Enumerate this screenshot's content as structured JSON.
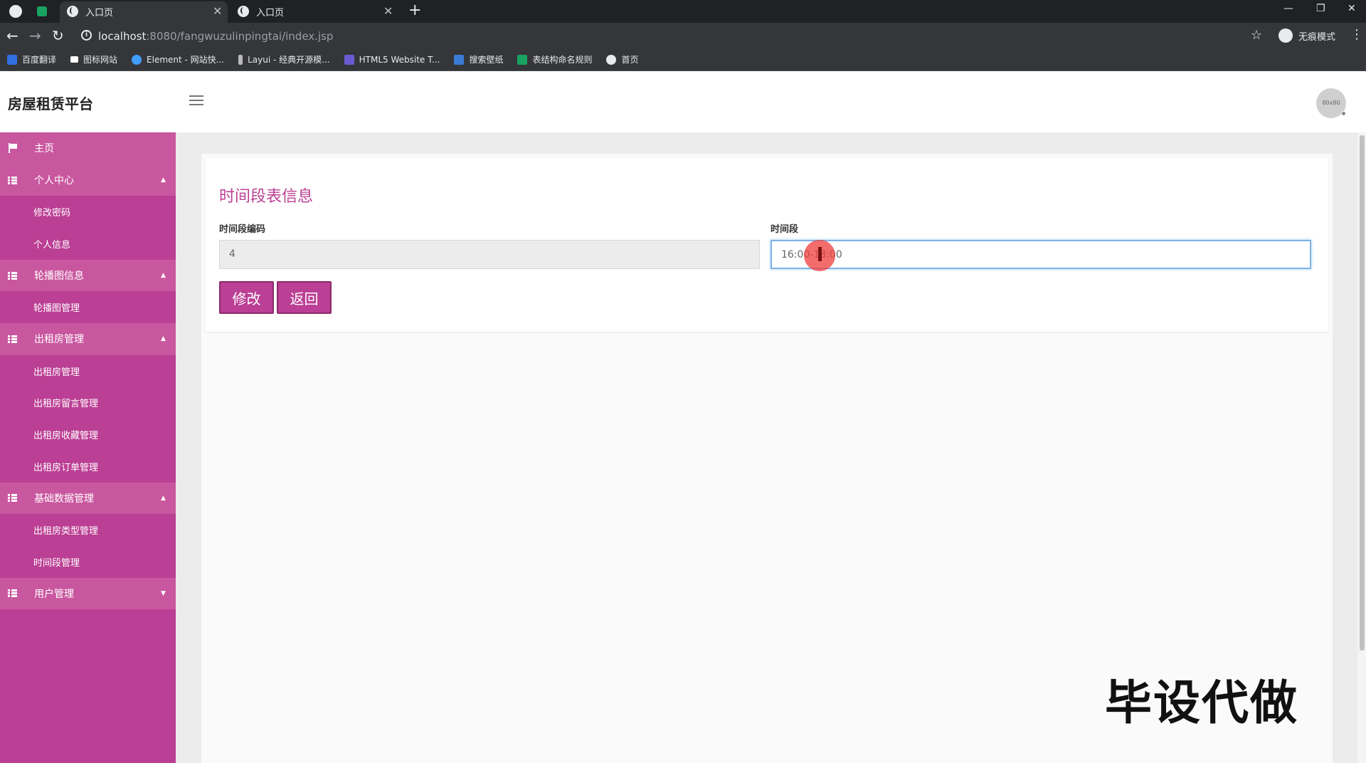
{
  "browser": {
    "tabs": [
      {
        "label": "入口页",
        "active": true
      },
      {
        "label": "入口页",
        "active": false
      }
    ],
    "url_host": "localhost",
    "url_rest": ":8080/fangwuzulinpingtai/index.jsp",
    "incognito_label": "无痕模式",
    "bookmarks": [
      {
        "label": "百度翻译",
        "color": "#2f6fde"
      },
      {
        "label": "图标网站",
        "color": "#ffffff"
      },
      {
        "label": "Element - 网站快...",
        "color": "#409eff"
      },
      {
        "label": "Layui - 经典开源模...",
        "color": "#bbbbbb"
      },
      {
        "label": "HTML5 Website T...",
        "color": "#6b5bd3"
      },
      {
        "label": "搜索壁纸",
        "color": "#3a7bd5"
      },
      {
        "label": "表结构命名规则",
        "color": "#1aa260"
      },
      {
        "label": "首页",
        "color": "#e8eaed"
      }
    ]
  },
  "app": {
    "brand": "房屋租赁平台",
    "avatar_text": "80x80",
    "accent_color": "#bb3f94"
  },
  "sidebar": {
    "items": [
      {
        "label": "主页",
        "type": "home"
      },
      {
        "label": "个人中心",
        "type": "group"
      },
      {
        "label": "修改密码",
        "type": "sub"
      },
      {
        "label": "个人信息",
        "type": "sub"
      },
      {
        "label": "轮播图信息",
        "type": "group"
      },
      {
        "label": "轮播图管理",
        "type": "sub"
      },
      {
        "label": "出租房管理",
        "type": "group"
      },
      {
        "label": "出租房管理",
        "type": "sub"
      },
      {
        "label": "出租房留言管理",
        "type": "sub"
      },
      {
        "label": "出租房收藏管理",
        "type": "sub"
      },
      {
        "label": "出租房订单管理",
        "type": "sub"
      },
      {
        "label": "基础数据管理",
        "type": "group"
      },
      {
        "label": "出租房类型管理",
        "type": "sub"
      },
      {
        "label": "时间段管理",
        "type": "sub"
      },
      {
        "label": "用户管理",
        "type": "group"
      }
    ]
  },
  "form": {
    "title": "时间段表信息",
    "code_label": "时间段编码",
    "code_value": "4",
    "period_label": "时间段",
    "period_value": "16:00-18:00",
    "submit_label": "修改",
    "back_label": "返回"
  },
  "watermark": "毕设代做"
}
